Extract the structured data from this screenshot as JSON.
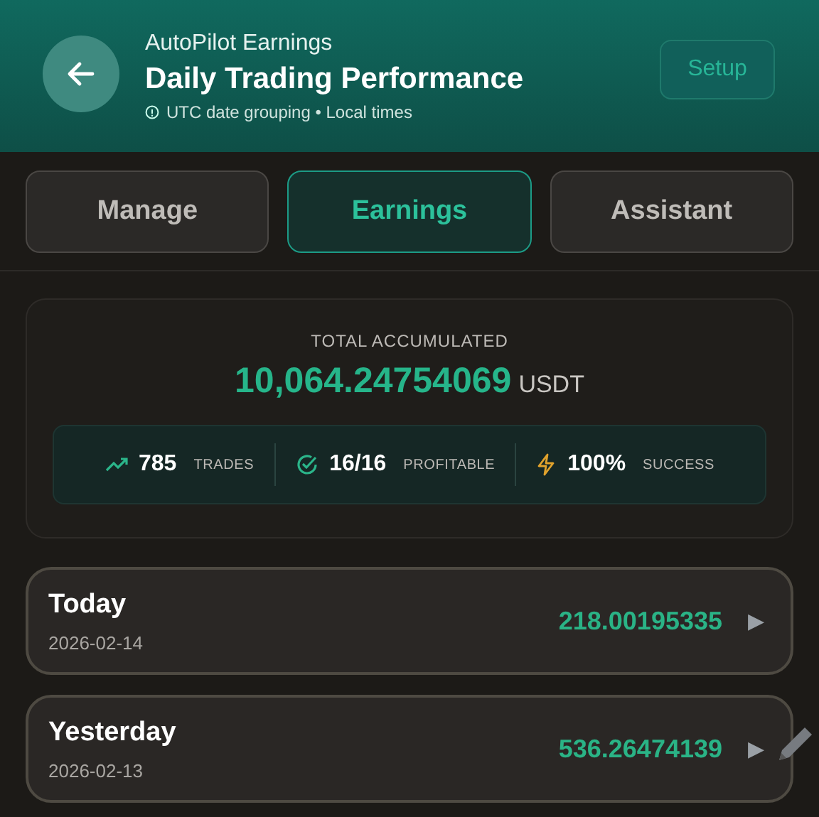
{
  "header": {
    "subtitle": "AutoPilot Earnings",
    "title": "Daily Trading Performance",
    "note": "UTC date grouping • Local times",
    "setup_button": "Setup"
  },
  "tabs": [
    {
      "label": "Manage",
      "selected": false
    },
    {
      "label": "Earnings",
      "selected": true
    },
    {
      "label": "Assistant",
      "selected": false
    }
  ],
  "summary": {
    "label": "TOTAL ACCUMULATED",
    "amount": "10,064.24754069",
    "unit": "USDT",
    "stats": [
      {
        "kind": "trend",
        "value": "785",
        "label": "TRADES"
      },
      {
        "kind": "check",
        "value": "16/16",
        "label": "PROFITABLE"
      },
      {
        "kind": "bolt",
        "value": "100%",
        "label": "SUCCESS"
      }
    ]
  },
  "days": [
    {
      "name": "Today",
      "date": "2026-02-14",
      "amount": "218.00195335",
      "arrow": "▶"
    },
    {
      "name": "Yesterday",
      "date": "2026-02-13",
      "amount": "536.26474139",
      "arrow": "▶"
    }
  ]
}
